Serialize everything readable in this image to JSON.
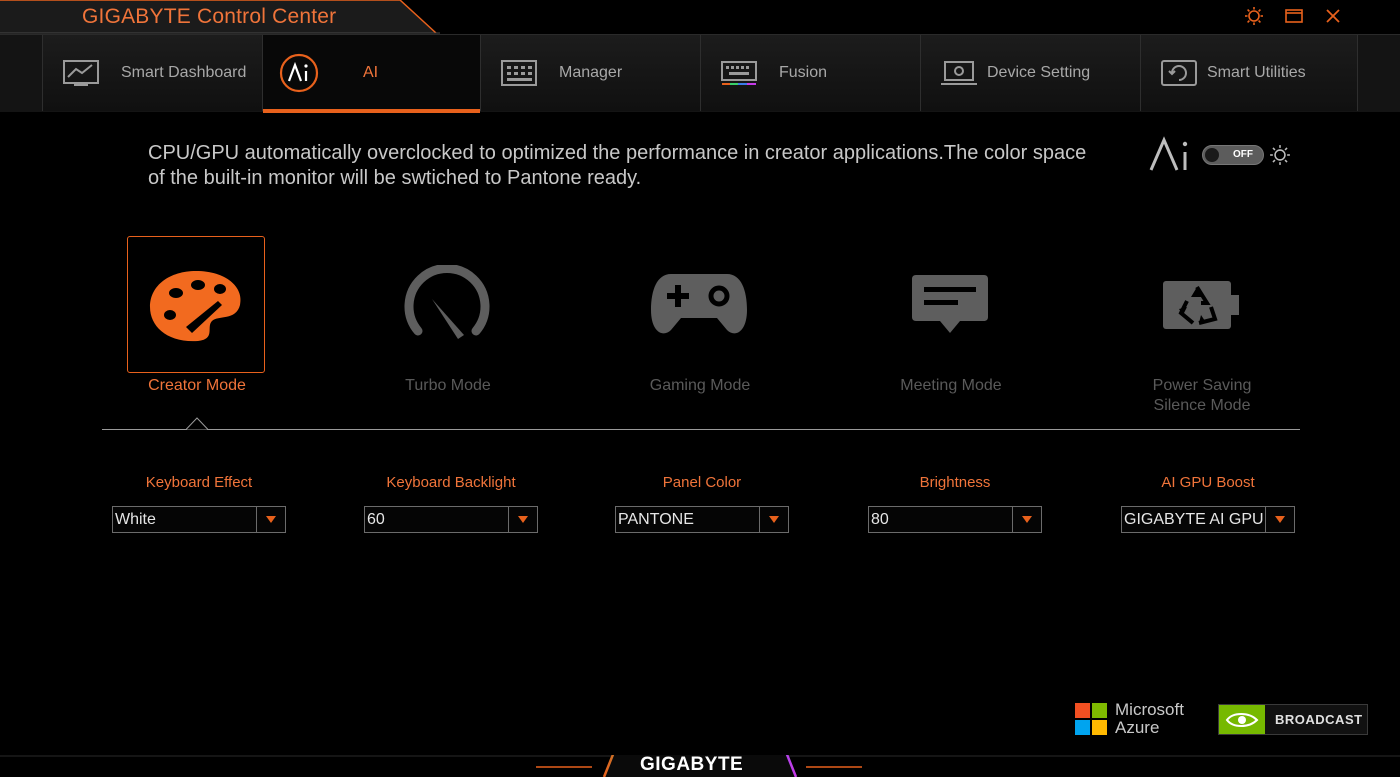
{
  "window": {
    "title": "GIGABYTE Control Center",
    "controls": [
      {
        "name": "settings",
        "icon": "sun-gear-icon"
      },
      {
        "name": "restore",
        "icon": "restore-window-icon"
      },
      {
        "name": "close",
        "icon": "close-icon"
      }
    ]
  },
  "tabs": [
    {
      "label": "Smart Dashboard",
      "icon": "dashboard-icon",
      "active": false
    },
    {
      "label": "AI",
      "icon": "ai-circle-icon",
      "active": true
    },
    {
      "label": "Manager",
      "icon": "manager-grid-icon",
      "active": false
    },
    {
      "label": "Fusion",
      "icon": "keyboard-rgb-icon",
      "active": false
    },
    {
      "label": "Device Setting",
      "icon": "laptop-gear-icon",
      "active": false
    },
    {
      "label": "Smart Utilities",
      "icon": "refresh-box-icon",
      "active": false
    }
  ],
  "description": "CPU/GPU automatically overclocked to optimized the performance in creator applications.The color space of the built-in monitor will be swtiched to Pantone ready.",
  "ai_toggle": {
    "state": "OFF"
  },
  "modes": [
    {
      "label": "Creator Mode",
      "icon": "palette-icon",
      "selected": true
    },
    {
      "label": "Turbo Mode",
      "icon": "speedometer-icon",
      "selected": false
    },
    {
      "label": "Gaming Mode",
      "icon": "gamepad-icon",
      "selected": false
    },
    {
      "label": "Meeting Mode",
      "icon": "chat-bubble-icon",
      "selected": false
    },
    {
      "label": "Power Saving\nSilence Mode",
      "icon": "battery-recycle-icon",
      "selected": false
    }
  ],
  "settings": [
    {
      "label": "Keyboard Effect",
      "value": "White"
    },
    {
      "label": "Keyboard Backlight",
      "value": "60"
    },
    {
      "label": "Panel Color",
      "value": "PANTONE"
    },
    {
      "label": "Brightness",
      "value": "80"
    },
    {
      "label": "AI GPU Boost",
      "value": "GIGABYTE AI GPU"
    }
  ],
  "partners": {
    "microsoft": {
      "line1": "Microsoft",
      "line2": "Azure"
    },
    "nvidia": {
      "label": "BROADCAST",
      "color": "#76b900"
    }
  },
  "footer": {
    "brand": "GIGABYTE"
  },
  "colors": {
    "accent": "#e8611c",
    "accent_text": "#f0743a",
    "inactive_mode": "#5a5a5a"
  }
}
